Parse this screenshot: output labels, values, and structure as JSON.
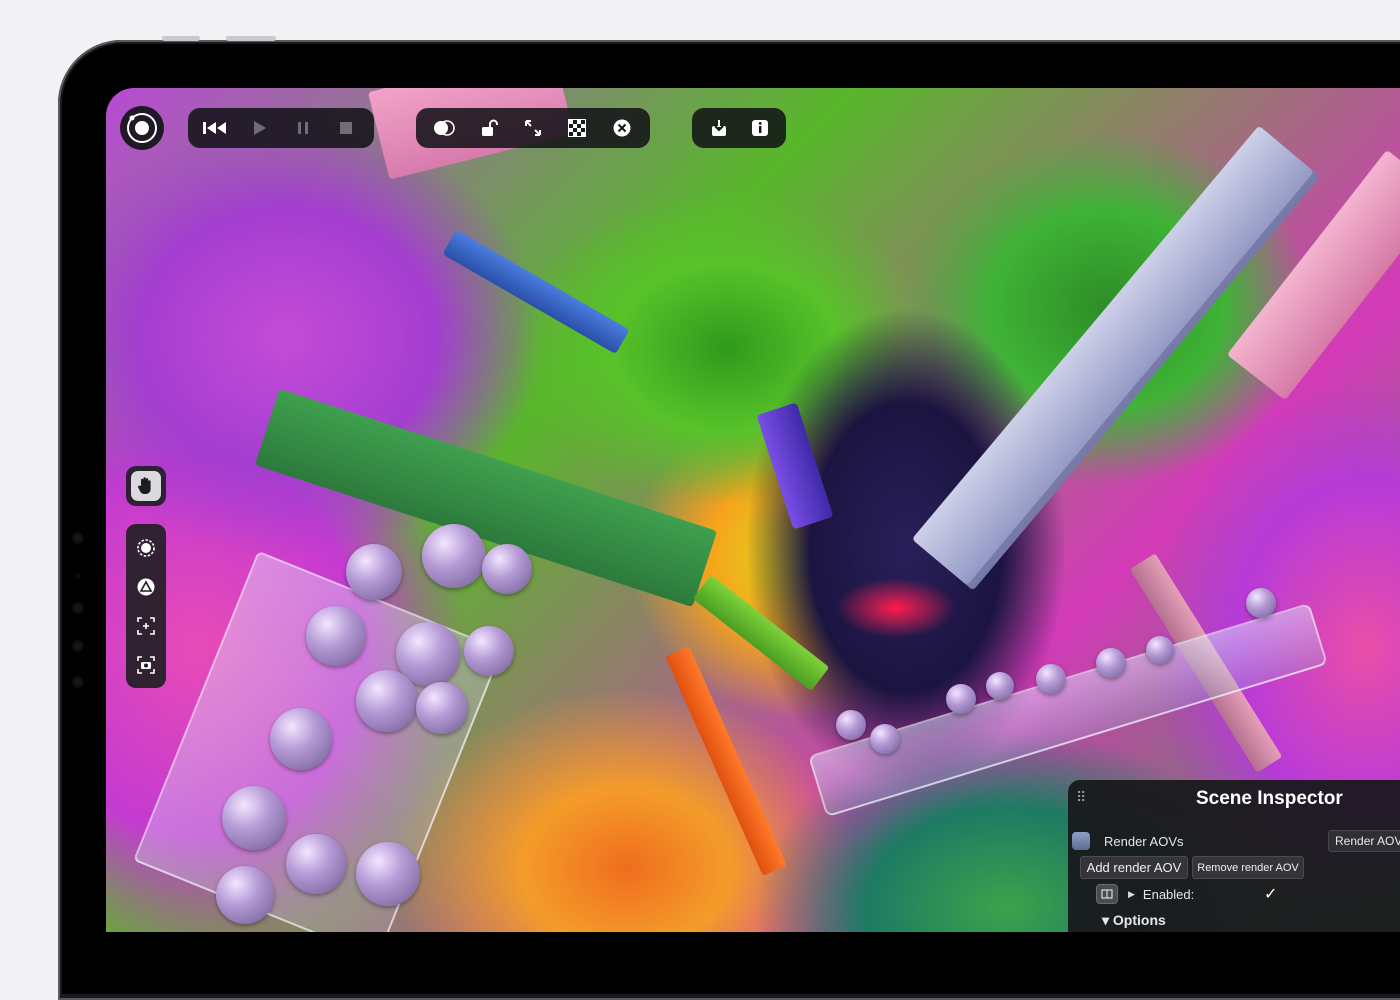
{
  "toolbar": {
    "app_logo_icon": "orbit-record-icon",
    "playback": [
      {
        "name": "skip-to-start",
        "icon": "skip-back-icon"
      },
      {
        "name": "play",
        "icon": "play-icon"
      },
      {
        "name": "pause",
        "icon": "pause-icon"
      },
      {
        "name": "stop",
        "icon": "stop-icon"
      }
    ],
    "view": [
      {
        "name": "compare",
        "icon": "overlap-circles-icon"
      },
      {
        "name": "lock",
        "icon": "unlock-icon"
      },
      {
        "name": "expand",
        "icon": "expand-icon"
      },
      {
        "name": "checkerboard",
        "icon": "checkerboard-icon"
      },
      {
        "name": "close",
        "icon": "close-circle-icon"
      }
    ],
    "output": [
      {
        "name": "save",
        "icon": "download-icon"
      },
      {
        "name": "info",
        "icon": "info-icon"
      }
    ]
  },
  "tools": [
    {
      "name": "hand",
      "icon": "hand-icon",
      "active": true
    },
    {
      "name": "focus",
      "icon": "focus-target-icon"
    },
    {
      "name": "object",
      "icon": "triangle-circle-icon"
    },
    {
      "name": "frame",
      "icon": "frame-select-icon"
    },
    {
      "name": "snapshot",
      "icon": "camera-icon"
    }
  ],
  "inspector": {
    "title": "Scene Inspector",
    "render_aovs_label": "Render AOVs",
    "render_aov_tab": "Render AOV",
    "add_button": "Add render AOV",
    "remove_button": "Remove render AOV",
    "enabled_label": "Enabled:",
    "enabled_checked": true,
    "enabled_mark": "✓",
    "options_label": "▾ Options"
  },
  "colors": {
    "panel": "#18181c",
    "toolbar": "#121216",
    "bezel": "#2b2b2e"
  }
}
